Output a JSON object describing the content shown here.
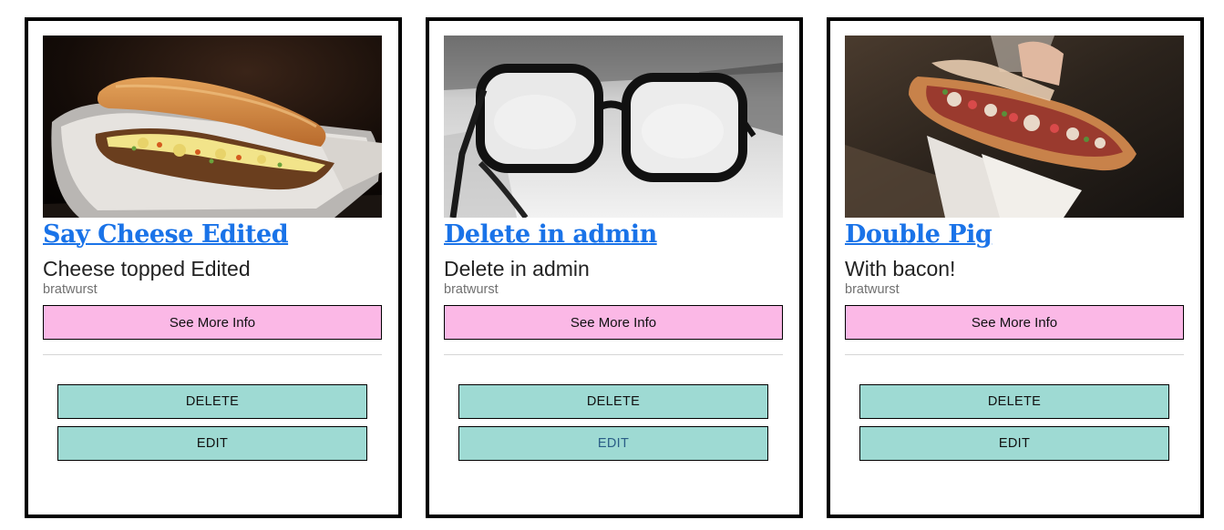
{
  "cards": [
    {
      "title": "Say Cheese Edited",
      "description": "Cheese topped Edited",
      "category": "bratwurst",
      "image": "sandwich-in-paper-tray-photo",
      "more_label": "See More Info",
      "delete_label": "DELETE",
      "edit_label": "EDIT"
    },
    {
      "title": "Delete in admin",
      "description": "Delete in admin",
      "category": "bratwurst",
      "image": "eyeglasses-black-and-white-photo",
      "more_label": "See More Info",
      "delete_label": "DELETE",
      "edit_label": "EDIT"
    },
    {
      "title": "Double Pig",
      "description": "With bacon!",
      "category": "bratwurst",
      "image": "loaded-hotdog-in-hand-photo",
      "more_label": "See More Info",
      "delete_label": "DELETE",
      "edit_label": "EDIT"
    }
  ],
  "colors": {
    "link": "#1a73e8",
    "more_button": "#fbb8e6",
    "action_button": "#9edad3",
    "card_border": "#000000"
  }
}
